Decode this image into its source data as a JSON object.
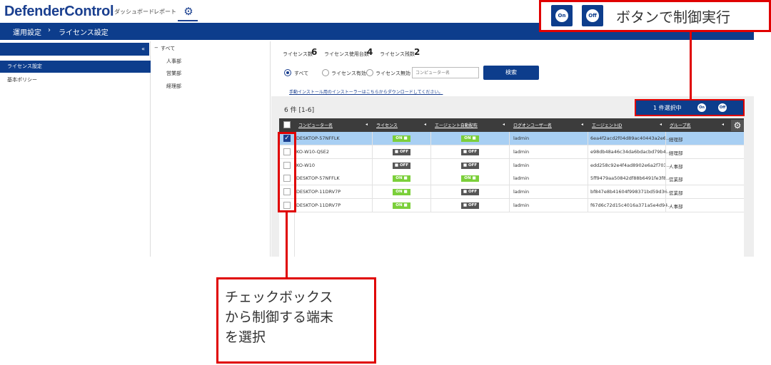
{
  "app": {
    "logo": "DefenderControl"
  },
  "nav": {
    "items": [
      "ダッシュボード",
      "レポート"
    ],
    "settings_icon": "gear-icon"
  },
  "breadcrumb": {
    "parent": "運用設定",
    "separator": "›",
    "current": "ライセンス設定"
  },
  "sidebar": {
    "collapse_label": "«",
    "items": [
      {
        "label": "ライセンス設定",
        "active": true
      },
      {
        "label": "基本ポリシー",
        "active": false
      }
    ]
  },
  "groups": {
    "root_toggle": "−",
    "root": "すべて",
    "children": [
      "人事部",
      "営業部",
      "経理部"
    ]
  },
  "summary": {
    "licenses_label": "ライセンス数",
    "licenses_value": "6",
    "used_label": "ライセンス使用台数",
    "used_value": "4",
    "remaining_label": "ライセンス残数",
    "remaining_value": "2"
  },
  "filter": {
    "options": [
      {
        "label": "すべて",
        "selected": true
      },
      {
        "label": "ライセンス有効",
        "selected": false
      },
      {
        "label": "ライセンス無効",
        "selected": false
      }
    ],
    "search_placeholder": "コンピューター名",
    "search_button": "検索",
    "download_link": "手動インストール用のインストーラーはこちらからダウンロードしてください。"
  },
  "list": {
    "count_label": "6 件 [1-6]",
    "selection_label": "1 件選択中",
    "on_icon_label": "On",
    "off_icon_label": "Off",
    "sort_arrow": "◂",
    "settings_glyph": "⚙",
    "check_glyph": "✓",
    "columns": [
      "コンピューター名",
      "ライセンス",
      "エージェント自動配布",
      "ログオンユーザー名",
      "エージェントID",
      "グループ名"
    ],
    "rows": [
      {
        "selected": true,
        "name": "DESKTOP-57NFFLK",
        "license": "ON ■",
        "license_on": true,
        "autodist": "ON ■",
        "autodist_on": true,
        "user": "ladmin",
        "agent_id": "6ea4f2acd2f04d89ac40443a2e6...",
        "group": "経理部"
      },
      {
        "selected": false,
        "name": "KO-W10-QSE2",
        "license": "■ OFF",
        "license_on": false,
        "autodist": "■ OFF",
        "autodist_on": false,
        "user": "ladmin",
        "agent_id": "e98db48a46c34da6bdacbd79b4...",
        "group": "経理部"
      },
      {
        "selected": false,
        "name": "KO-W10",
        "license": "■ OFF",
        "license_on": false,
        "autodist": "■ OFF",
        "autodist_on": false,
        "user": "ladmin",
        "agent_id": "edd258c92e4f4ad8902e6a2f703...",
        "group": "人事部"
      },
      {
        "selected": false,
        "name": "DESKTOP-57NFFLK",
        "license": "ON ■",
        "license_on": true,
        "autodist": "ON ■",
        "autodist_on": true,
        "user": "ladmin",
        "agent_id": "5ff9479aa50842df88b6491fe3f8...",
        "group": "営業部"
      },
      {
        "selected": false,
        "name": "DESKTOP-11DRV7P",
        "license": "ON ■",
        "license_on": true,
        "autodist": "■ OFF",
        "autodist_on": false,
        "user": "ladmin",
        "agent_id": "bf847e8b41604f998371bd59d36...",
        "group": "営業部"
      },
      {
        "selected": false,
        "name": "DESKTOP-11DRV7P",
        "license": "ON ■",
        "license_on": true,
        "autodist": "■ OFF",
        "autodist_on": false,
        "user": "ladmin",
        "agent_id": "f67d6c72d15c4016a371a5e4d94...",
        "group": "人事部"
      }
    ]
  },
  "callouts": {
    "top_text": "ボタンで制御実行",
    "bottom_text": "チェックボックス\nから制御する端末\nを選択"
  },
  "colors": {
    "brand": "#0d3d8c",
    "on": "#7bcf3a",
    "off": "#555555",
    "highlight": "#e00000",
    "selected_row": "#a8cff3"
  }
}
